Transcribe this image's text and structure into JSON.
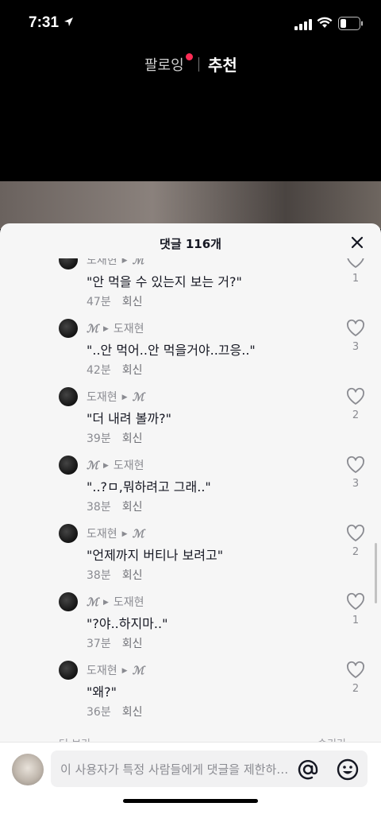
{
  "status_bar": {
    "time": "7:31"
  },
  "top_nav": {
    "following": "팔로잉",
    "for_you": "추천"
  },
  "comments_sheet": {
    "title": "댓글 116개",
    "comments": [
      {
        "author": "도재현",
        "reply_to": "ℳ",
        "author_script": false,
        "text": "\"안 먹을 수 있는지 보는 거?\"",
        "time": "47분",
        "reply": "회신",
        "likes": "1"
      },
      {
        "author": "ℳ",
        "reply_to": "도재현",
        "author_script": true,
        "text": "\"..안 먹어..안 먹을거야..끄응..\"",
        "time": "42분",
        "reply": "회신",
        "likes": "3"
      },
      {
        "author": "도재현",
        "reply_to": "ℳ",
        "author_script": false,
        "text": "\"더 내려 볼까?\"",
        "time": "39분",
        "reply": "회신",
        "likes": "2"
      },
      {
        "author": "ℳ",
        "reply_to": "도재현",
        "author_script": true,
        "text": "\"..?ㅁ,뭐하려고 그래..\"",
        "time": "38분",
        "reply": "회신",
        "likes": "3"
      },
      {
        "author": "도재현",
        "reply_to": "ℳ",
        "author_script": false,
        "text": "\"언제까지 버티나 보려고\"",
        "time": "38분",
        "reply": "회신",
        "likes": "2"
      },
      {
        "author": "ℳ",
        "reply_to": "도재현",
        "author_script": true,
        "text": "\"?야..하지마..\"",
        "time": "37분",
        "reply": "회신",
        "likes": "1"
      },
      {
        "author": "도재현",
        "reply_to": "ℳ",
        "author_script": false,
        "text": "\"왜?\"",
        "time": "36분",
        "reply": "회신",
        "likes": "2"
      }
    ],
    "more_left": "더 보기",
    "more_right": "숨기기"
  },
  "input_bar": {
    "placeholder": "이 사용자가 특정 사람들에게 댓글을 제한하고 있습니다"
  },
  "colors": {
    "sheet_bg": "#f6f6f6",
    "text": "#161823",
    "muted": "#8a8b91",
    "live_dot": "#fe2c55"
  }
}
